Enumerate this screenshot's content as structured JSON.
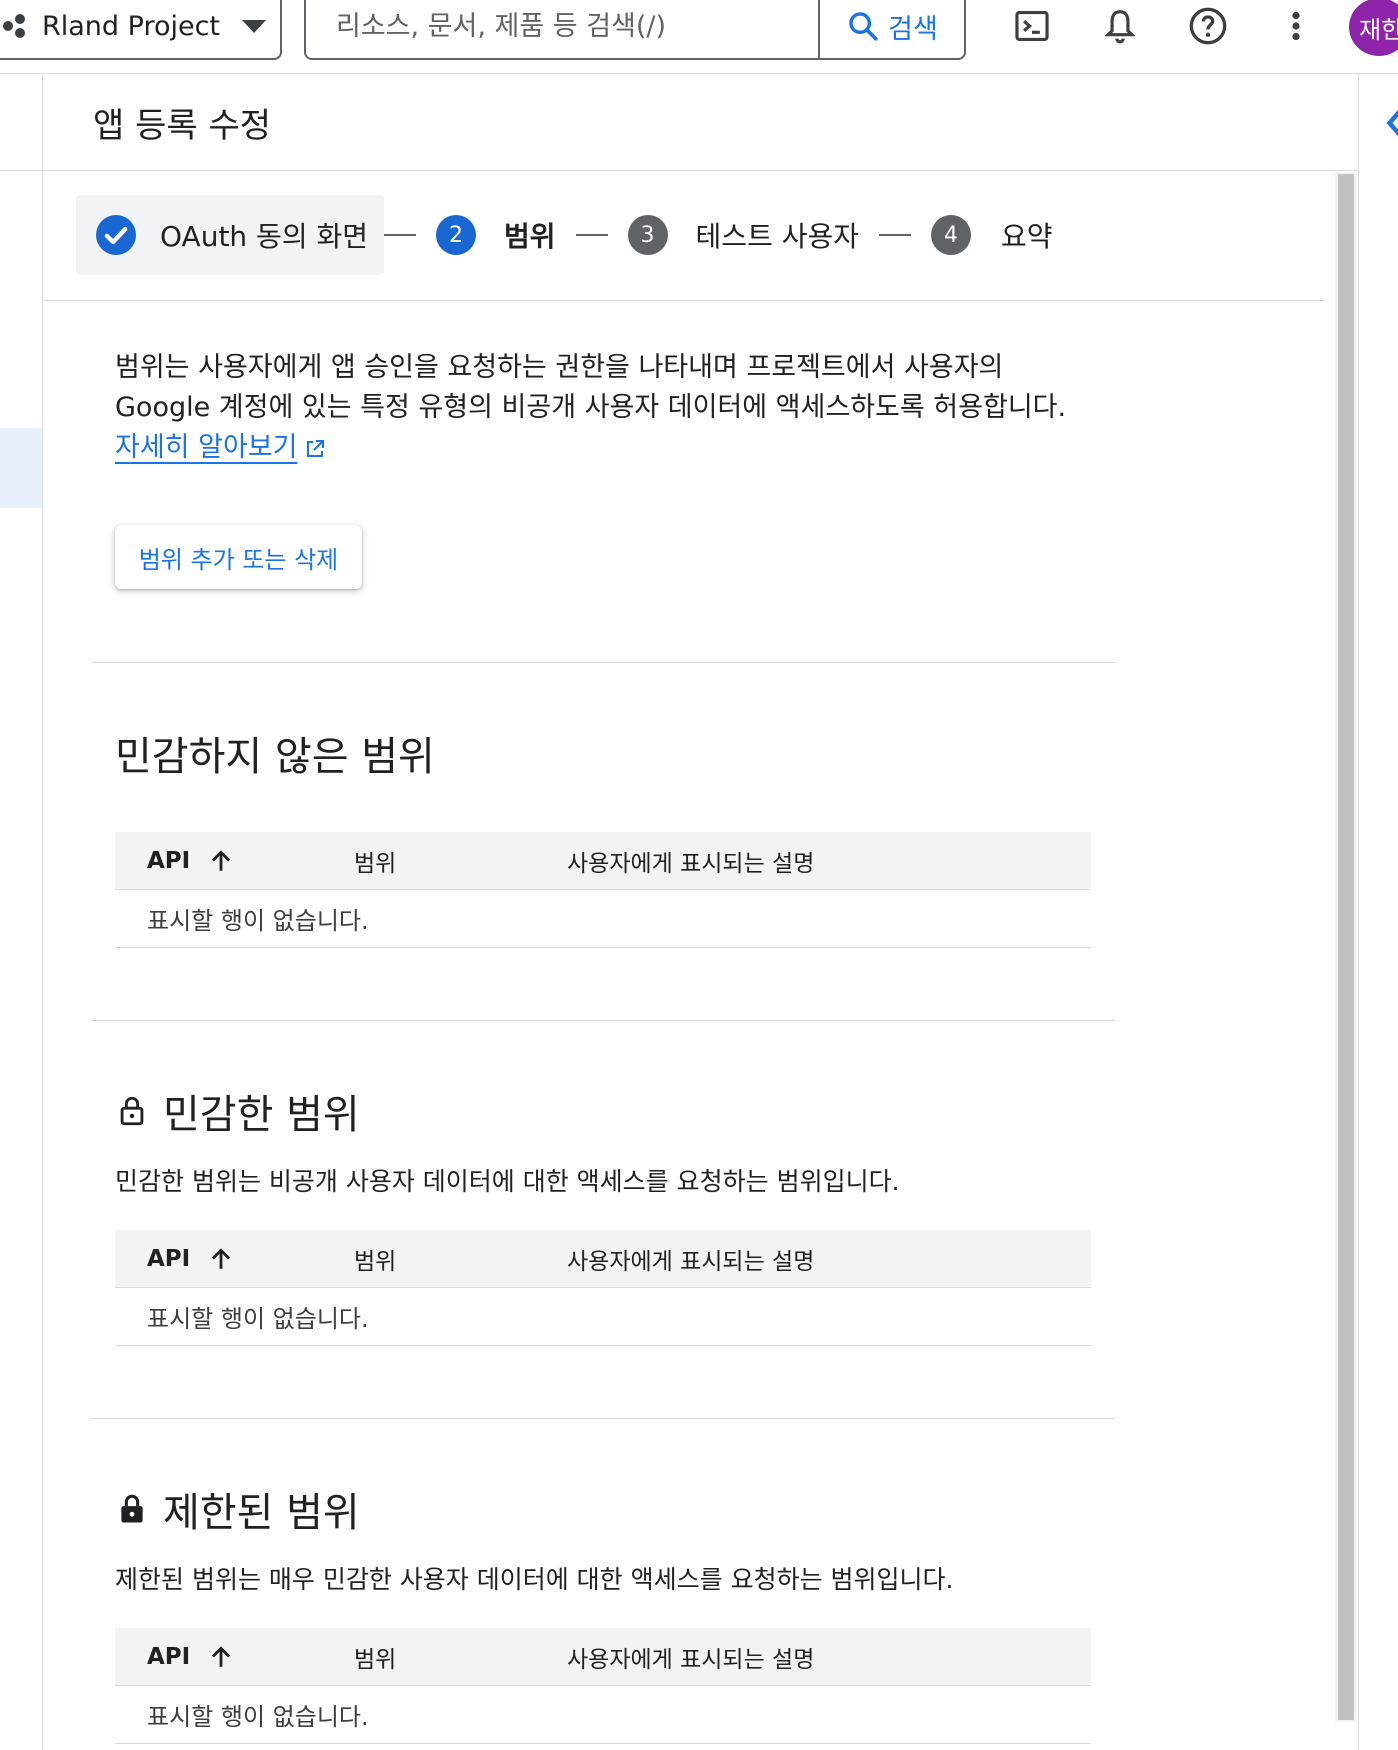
{
  "topbar": {
    "project_name": "Rland Project",
    "search_placeholder": "리소스, 문서, 제품 등 검색(/)",
    "search_button_label": "검색",
    "avatar_label": "재한",
    "icons": [
      "cloud-shell-icon",
      "bell-icon",
      "help-icon",
      "more-vert-icon"
    ]
  },
  "page": {
    "title": "앱 등록 수정"
  },
  "stepper": {
    "steps": [
      {
        "number": "",
        "label": "OAuth 동의 화면",
        "state": "done"
      },
      {
        "number": "2",
        "label": "범위",
        "state": "active"
      },
      {
        "number": "3",
        "label": "테스트 사용자",
        "state": "pending"
      },
      {
        "number": "4",
        "label": "요약",
        "state": "pending"
      }
    ]
  },
  "intro": {
    "line1": "범위는 사용자에게 앱 승인을 요청하는 권한을 나타내며 프로젝트에서 사용자의",
    "line2": "Google 계정에 있는 특정 유형의 비공개 사용자 데이터에 액세스하도록 허용합니다.",
    "learn_more": "자세히 알아보기"
  },
  "add_scope_button": "범위 추가 또는 삭제",
  "table_headers": {
    "api": "API",
    "scope": "범위",
    "description": "사용자에게 표시되는 설명"
  },
  "sections": [
    {
      "title": "민감하지 않은 범위",
      "description": "",
      "empty_text": "표시할 행이 없습니다."
    },
    {
      "title": "민감한 범위",
      "description": "민감한 범위는 비공개 사용자 데이터에 대한 액세스를 요청하는 범위입니다.",
      "empty_text": "표시할 행이 없습니다."
    },
    {
      "title": "제한된 범위",
      "description": "제한된 범위는 매우 민감한 사용자 데이터에 대한 액세스를 요청하는 범위입니다.",
      "empty_text": "표시할 행이 없습니다."
    }
  ],
  "colors": {
    "accent": "#1a73e8",
    "step_active": "#1967d2",
    "step_pending": "#5f6368",
    "avatar": "#8e24aa"
  }
}
